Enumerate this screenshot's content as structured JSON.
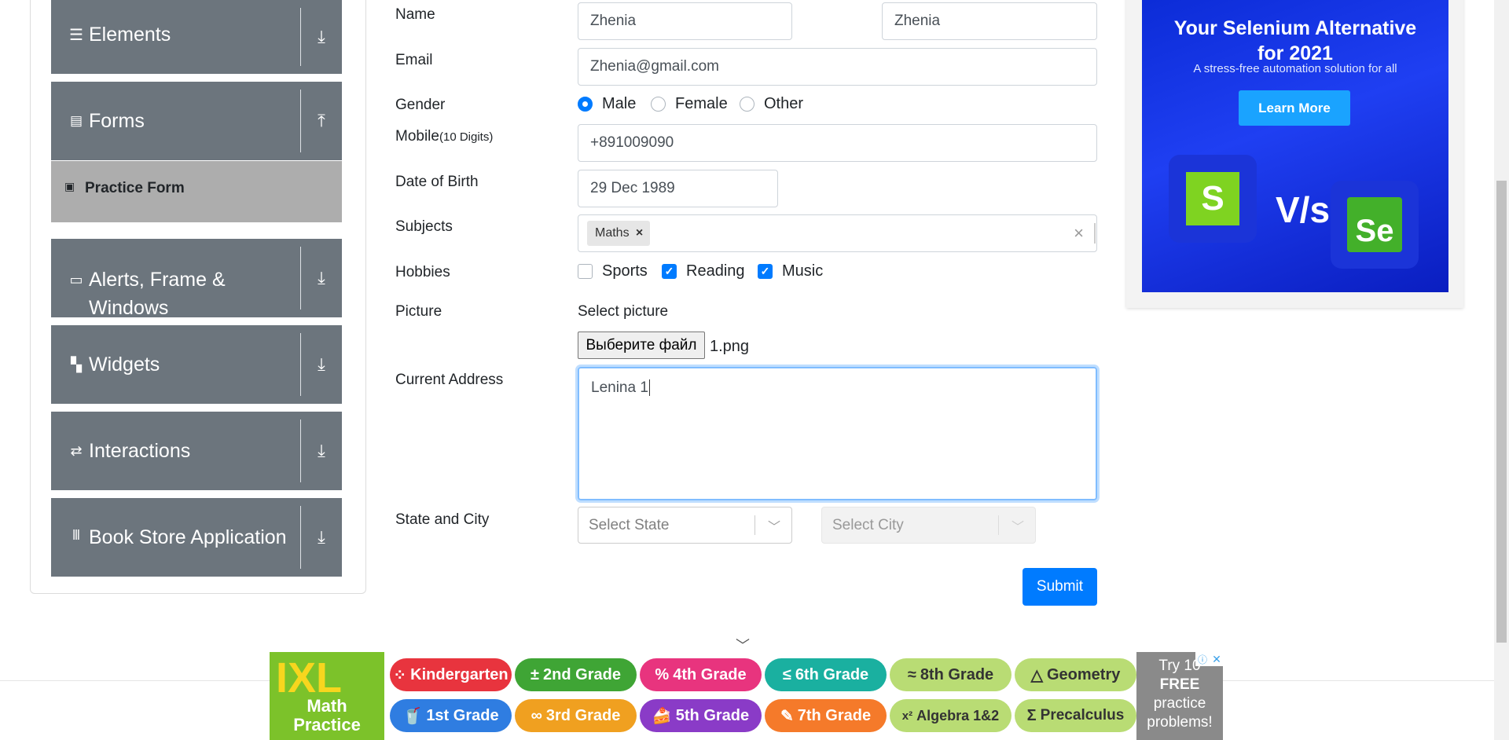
{
  "sidebar": {
    "groups": [
      {
        "label": "Elements",
        "icon": "hamburger-icon",
        "toggle": "download-icon"
      },
      {
        "label": "Forms",
        "icon": "document-icon",
        "toggle": "upload-icon"
      },
      {
        "label": "Alerts, Frame & Windows",
        "label_line1": "Alerts, Frame &",
        "label_line2": "Windows",
        "icon": "window-icon",
        "toggle": "download-icon"
      },
      {
        "label": "Widgets",
        "icon": "widgets-icon",
        "toggle": "download-icon"
      },
      {
        "label": "Interactions",
        "icon": "interactions-icon",
        "toggle": "download-icon"
      },
      {
        "label": "Book Store Application",
        "icon": "books-icon",
        "toggle": "download-icon"
      }
    ],
    "active_item": {
      "label": "Practice Form",
      "icon": "html5-icon"
    }
  },
  "form": {
    "name": {
      "label": "Name",
      "first": "Zhenia",
      "last": "Zhenia"
    },
    "email": {
      "label": "Email",
      "value": "Zhenia@gmail.com"
    },
    "gender": {
      "label": "Gender",
      "options": [
        "Male",
        "Female",
        "Other"
      ],
      "selected": "Male"
    },
    "mobile": {
      "label": "Mobile",
      "hint": "(10 Digits)",
      "value": "+891009090"
    },
    "dob": {
      "label": "Date of Birth",
      "value": "29 Dec 1989"
    },
    "subjects": {
      "label": "Subjects",
      "chips": [
        "Maths"
      ],
      "clear": "×",
      "remove": "×"
    },
    "hobbies": {
      "label": "Hobbies",
      "options": [
        {
          "label": "Sports",
          "checked": false
        },
        {
          "label": "Reading",
          "checked": true
        },
        {
          "label": "Music",
          "checked": true
        }
      ]
    },
    "picture": {
      "label": "Picture",
      "caption": "Select picture",
      "button": "Выберите файл",
      "file": "1.png"
    },
    "address": {
      "label": "Current Address",
      "value": "Lenina 1"
    },
    "state_city": {
      "label": "State and City",
      "state_placeholder": "Select State",
      "city_placeholder": "Select City"
    },
    "submit": "Submit"
  },
  "ad_right": {
    "headline_1": "Your Selenium Alternative",
    "headline_2": "for 2021",
    "subline": "A stress-free automation solution for all",
    "cta": "Learn More",
    "left_logo": "S",
    "vs": "V/s",
    "right_logo": "Se"
  },
  "ad_bottom": {
    "brand": "IXL",
    "tagline_1": "Math",
    "tagline_2": "Practice",
    "grades_row1": [
      {
        "label": "Kindergarten",
        "glyph": "⁘",
        "color": "#e8343e"
      },
      {
        "label": "2nd Grade",
        "glyph": "±",
        "color": "#3fa535"
      },
      {
        "label": "4th Grade",
        "glyph": "%",
        "color": "#e8347e"
      },
      {
        "label": "6th Grade",
        "glyph": "≤",
        "color": "#1ab0a0"
      },
      {
        "label": "8th Grade",
        "glyph": "≈",
        "color": "#b9dc74"
      },
      {
        "label": "Geometry",
        "glyph": "△",
        "color": "#b9dc74"
      }
    ],
    "grades_row2": [
      {
        "label": "1st Grade",
        "glyph": "🥤",
        "color": "#2f7de1"
      },
      {
        "label": "3rd Grade",
        "glyph": "∞",
        "color": "#f0a020"
      },
      {
        "label": "5th Grade",
        "glyph": "🍰",
        "color": "#8a3bc7"
      },
      {
        "label": "7th Grade",
        "glyph": "✎",
        "color": "#f57a2a"
      },
      {
        "label": "Algebra 1&2",
        "glyph": "x²",
        "color": "#b9dc74"
      },
      {
        "label": "Precalculus",
        "glyph": "Σ",
        "color": "#b9dc74"
      }
    ],
    "try_text": "Try 10 FREE practice problems!",
    "try_line1": "Try 10",
    "try_line2": "FREE",
    "try_line3": "practice",
    "try_line4": "problems!",
    "close": "✕",
    "info": "ⓘ"
  },
  "colors": {
    "primary": "#007bff",
    "sidebar": "#6c757d",
    "active": "#adadad"
  }
}
